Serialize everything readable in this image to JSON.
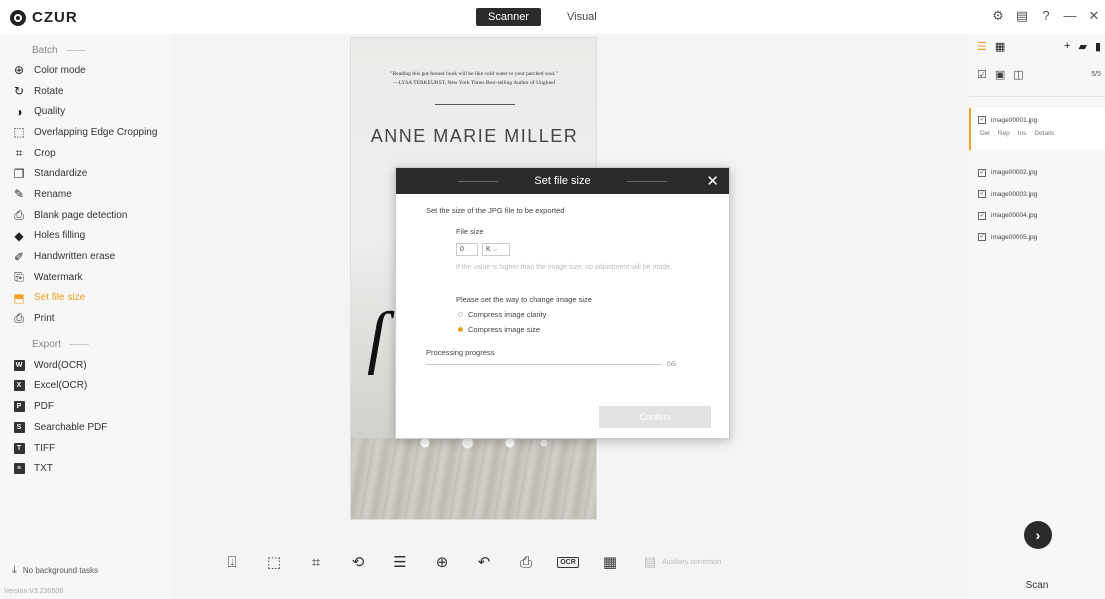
{
  "app": {
    "logo_text": "CZUR",
    "version": "Version:V3.230508"
  },
  "mode_tabs": [
    {
      "label": "Scanner",
      "active": true
    },
    {
      "label": "Visual",
      "active": false
    }
  ],
  "window_controls": {
    "settings_icon": "gear-icon",
    "chat_icon": "message-icon",
    "help_icon": "help-icon",
    "minimize": "—",
    "close": "✕"
  },
  "sidebar": {
    "batch_title": "Batch",
    "batch_items": [
      {
        "label": "Color mode",
        "icon": "color-mode-icon",
        "glyph": "⊕",
        "active": false
      },
      {
        "label": "Rotate",
        "icon": "rotate-icon",
        "glyph": "↻",
        "active": false
      },
      {
        "label": "Quality",
        "icon": "quality-icon",
        "glyph": "◑",
        "active": false
      },
      {
        "label": "Overlapping Edge Cropping",
        "icon": "edge-crop-icon",
        "glyph": "⬚",
        "active": false
      },
      {
        "label": "Crop",
        "icon": "crop-icon",
        "glyph": "⌗",
        "active": false
      },
      {
        "label": "Standardize",
        "icon": "standardize-icon",
        "glyph": "❐",
        "active": false
      },
      {
        "label": "Rename",
        "icon": "rename-icon",
        "glyph": "✎",
        "active": false
      },
      {
        "label": "Blank page detection",
        "icon": "blank-page-icon",
        "glyph": "⎙",
        "active": false
      },
      {
        "label": "Holes filling",
        "icon": "holes-filling-icon",
        "glyph": "◆",
        "active": false
      },
      {
        "label": "Handwritten erase",
        "icon": "handwritten-erase-icon",
        "glyph": "✐",
        "active": false
      },
      {
        "label": "Watermark",
        "icon": "watermark-icon",
        "glyph": "⎘",
        "active": false
      },
      {
        "label": "Set file size",
        "icon": "file-size-icon",
        "glyph": "⬒",
        "active": true
      },
      {
        "label": "Print",
        "icon": "print-icon",
        "glyph": "⎙",
        "active": false
      }
    ],
    "export_title": "Export",
    "export_items": [
      {
        "label": "Word(OCR)",
        "icon": "word-icon",
        "glyph": "W"
      },
      {
        "label": "Excel(OCR)",
        "icon": "excel-icon",
        "glyph": "X"
      },
      {
        "label": "PDF",
        "icon": "pdf-icon",
        "glyph": "P"
      },
      {
        "label": "Searchable PDF",
        "icon": "searchable-pdf-icon",
        "glyph": "S"
      },
      {
        "label": "TIFF",
        "icon": "tiff-icon",
        "glyph": "T"
      },
      {
        "label": "TXT",
        "icon": "txt-icon",
        "glyph": "≡"
      }
    ],
    "background_tasks": "No background tasks"
  },
  "book": {
    "quote_line1": "\"Reading this gut-honest book will be like cold water to your parched soul.\"",
    "quote_line2": "—LYSA TERKEURST, New York Times Best-selling Author of Unglued",
    "author": "ANNE MARIE MILLER"
  },
  "bottom_toolbar": {
    "aux_label": "Auxiliary correction"
  },
  "dialog": {
    "title": "Set file size",
    "description": "Set the size of the JPG file to be exported",
    "file_size_label": "File size",
    "file_size_value": "0",
    "unit": "K",
    "hint": "If the value is higher than the image size, no adjustment will be made.",
    "method_title": "Please set the way to change image size",
    "options": [
      {
        "label": "Compress image clarity",
        "selected": false
      },
      {
        "label": "Compress image size",
        "selected": true
      }
    ],
    "progress_label": "Processing progress",
    "progress_count": "0/5",
    "progress": 0,
    "confirm": "Confirm"
  },
  "right_panel": {
    "count": "5/5",
    "active_file": "image00001.jpg",
    "file_actions": [
      "Del",
      "Rep",
      "Ins",
      "Details"
    ],
    "files": [
      "image00002.jpg",
      "image00003.jpg",
      "image00004.jpg",
      "image00005.jpg"
    ],
    "scan_label": "Scan"
  },
  "colors": {
    "accent": "#f0a020",
    "dark": "#2b2b2b"
  }
}
